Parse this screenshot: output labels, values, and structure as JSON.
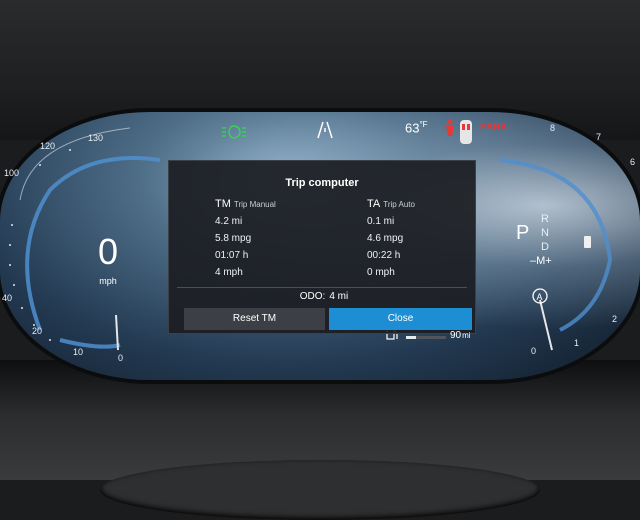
{
  "cluster": {
    "speed": {
      "value": "0",
      "unit": "mph"
    },
    "speedometer_ticks": [
      "130",
      "120",
      "100",
      "40",
      "20",
      "10",
      "0"
    ],
    "tachometer_ticks": [
      "8",
      "7",
      "6",
      "2",
      "1",
      "0"
    ],
    "outside_temperature": {
      "value": "63",
      "unit": "°F"
    },
    "park_indicator": "PARK",
    "gear_selector": {
      "current": "P",
      "options": [
        "R",
        "N",
        "D"
      ],
      "manual": "–M+"
    },
    "fuel": {
      "level_fraction": 0.25,
      "range_value": "90",
      "range_unit": "mi"
    },
    "indicator_colors": {
      "headlights": "#39d353",
      "park_brake": "#e53935",
      "accent": "#1d8ed3"
    }
  },
  "trip_computer": {
    "title": "Trip computer",
    "manual": {
      "abbr": "TM",
      "label": "Trip Manual",
      "distance": "4.2 mi",
      "economy": "5.8 mpg",
      "time": "01:07 h",
      "avg_speed": "4 mph"
    },
    "auto": {
      "abbr": "TA",
      "label": "Trip Auto",
      "distance": "0.1 mi",
      "economy": "4.6 mpg",
      "time": "00:22 h",
      "avg_speed": "0 mph"
    },
    "odo_label": "ODO:",
    "odo_value": "4 mi",
    "reset_button": "Reset TM",
    "close_button": "Close"
  },
  "icons": [
    "headlight-icon",
    "road-lane-icon",
    "seatbelt-warning-icon",
    "car-door-icon",
    "fuel-pump-icon",
    "auto-hold-icon",
    "battery-icon"
  ]
}
